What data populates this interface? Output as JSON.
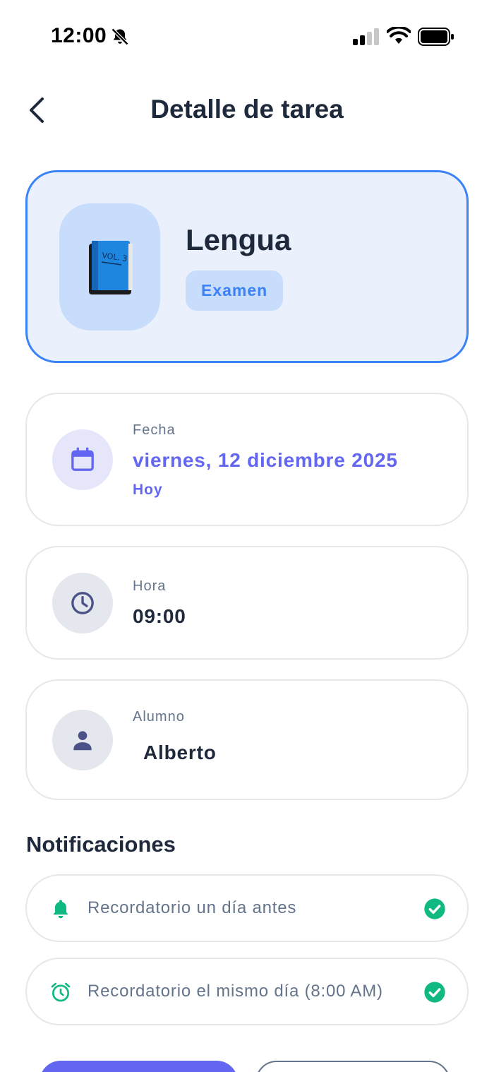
{
  "status_bar": {
    "time": "12:00",
    "icons": [
      "bell-off-icon",
      "signal-icon",
      "wifi-icon",
      "battery-icon"
    ]
  },
  "header": {
    "title": "Detalle de tarea",
    "back_icon": "chevron-left-icon"
  },
  "subject": {
    "name": "Lengua",
    "type": "Examen",
    "icon": "book-icon",
    "accent_color": "#3b82f6"
  },
  "date": {
    "label": "Fecha",
    "value": "viernes, 12 diciembre 2025",
    "relative": "Hoy",
    "icon": "calendar-icon",
    "color": "#6366f1"
  },
  "time": {
    "label": "Hora",
    "value": "09:00",
    "icon": "clock-icon"
  },
  "student": {
    "label": "Alumno",
    "value": "Alberto",
    "icon": "person-icon"
  },
  "notifications": {
    "heading": "Notificaciones",
    "items": [
      {
        "text": "Recordatorio un día antes",
        "icon": "bell-icon",
        "enabled": true
      },
      {
        "text": "Recordatorio el mismo día (8:00 AM)",
        "icon": "alarm-clock-icon",
        "enabled": true
      }
    ],
    "color": "#10b981"
  },
  "colors": {
    "primary": "#6366f1",
    "text": "#1e293b",
    "muted": "#64748b"
  }
}
